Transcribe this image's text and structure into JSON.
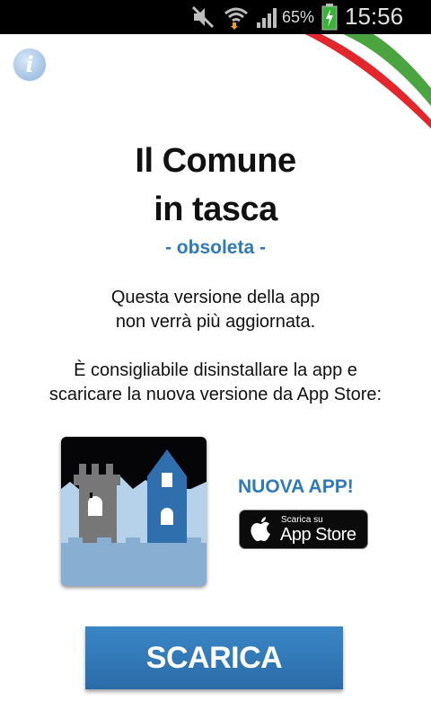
{
  "status_bar": {
    "battery_percent": "65%",
    "time": "15:56",
    "icons": [
      "muted-icon",
      "wifi-icon",
      "signal-icon",
      "battery-charging-icon"
    ]
  },
  "header": {
    "info_glyph": "i",
    "flag_colors": [
      "#e2262c",
      "#ffffff",
      "#4aa540"
    ]
  },
  "main": {
    "title_line1": "Il Comune",
    "title_line2": "in tasca",
    "subtitle": "- obsoleta -",
    "message_line1": "Questa versione della app",
    "message_line2": "non verrà più aggiornata.",
    "advice_line1": "È consigliabile disinstallare la app e",
    "advice_line2": "scaricare la nuova versione da App Store:"
  },
  "promo": {
    "new_app_label": "NUOVA APP!",
    "badge_small": "Scarica su",
    "badge_big": "App Store",
    "app_icon_name": "town-towers-app-icon"
  },
  "action": {
    "download_label": "SCARICA"
  },
  "colors": {
    "accent": "#2f7ab8",
    "button": "#2f76b6",
    "status_bar_bg": "#000000"
  }
}
